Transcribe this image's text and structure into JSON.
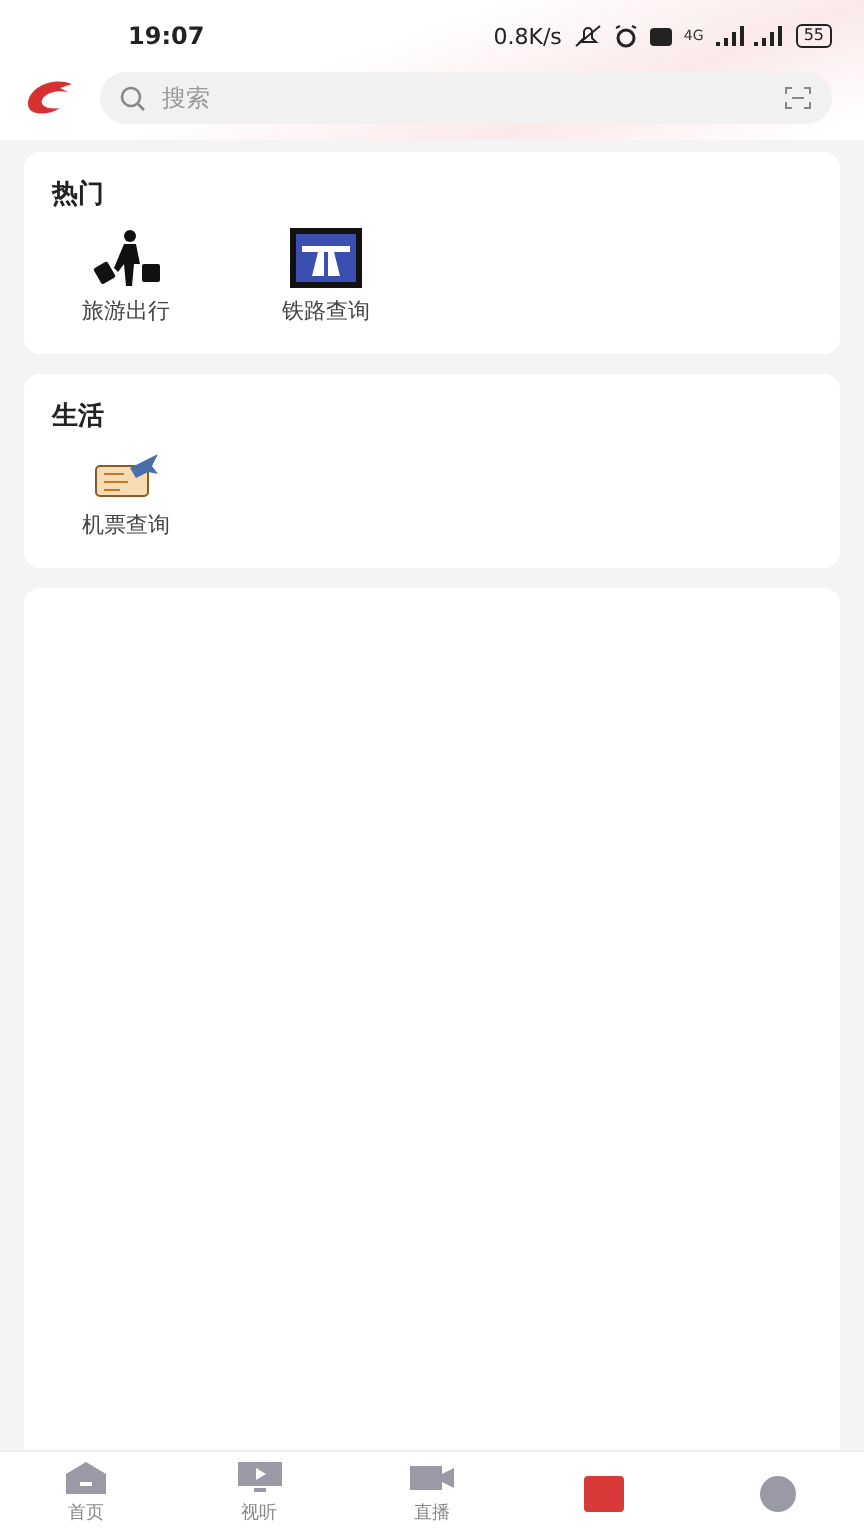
{
  "status_bar": {
    "time": "19:07",
    "speed": "0.8K/s",
    "network": "4G",
    "battery": "55"
  },
  "search": {
    "placeholder": "搜索"
  },
  "sections": [
    {
      "title": "热门",
      "items": [
        {
          "label": "旅游出行",
          "kind": "travel"
        },
        {
          "label": "铁路查询",
          "kind": "road"
        }
      ]
    },
    {
      "title": "生活",
      "items": [
        {
          "label": "机票查询",
          "kind": "ticket"
        }
      ]
    }
  ],
  "tab_bar": [
    {
      "label": "首页",
      "kind": "home",
      "selected": false
    },
    {
      "label": "视听",
      "kind": "tv",
      "selected": false
    },
    {
      "label": "直播",
      "kind": "camera",
      "selected": false
    },
    {
      "kind": "square",
      "selected": true
    },
    {
      "kind": "circle",
      "selected": false
    }
  ]
}
